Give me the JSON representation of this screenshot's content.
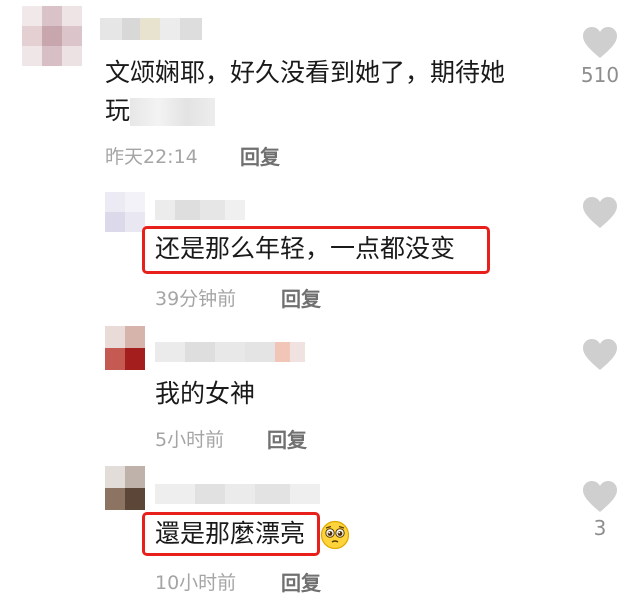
{
  "comments": [
    {
      "text_line1": "文颂娴耶，好久没看到她了，期待她",
      "text_line2": "玩",
      "time": "昨天22:14",
      "reply_label": "回复",
      "like_count": "510"
    },
    {
      "text": "还是那么年轻，一点都没变",
      "time": "39分钟前",
      "reply_label": "回复",
      "like_count": ""
    },
    {
      "text": "我的女神",
      "time": "5小时前",
      "reply_label": "回复",
      "like_count": ""
    },
    {
      "text": "還是那麼漂亮",
      "time": "10小时前",
      "reply_label": "回复",
      "like_count": "3"
    }
  ],
  "colors": {
    "highlight": "#e8201c",
    "heart": "#cfcfcf",
    "time_text": "#a5a5a5"
  },
  "icons": {
    "like": "heart-icon",
    "emoji": "pleading-face-emoji"
  }
}
